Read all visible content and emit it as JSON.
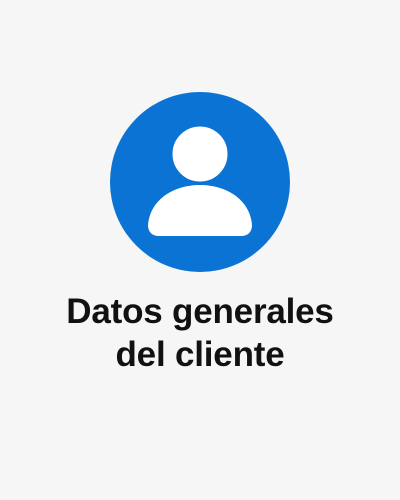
{
  "card": {
    "title_line1": "Datos generales",
    "title_line2": "del cliente",
    "icon": "user-profile-icon",
    "colors": {
      "background": "#f6f6f6",
      "accent": "#0b73d3",
      "icon_foreground": "#ffffff",
      "text": "#111111"
    }
  }
}
